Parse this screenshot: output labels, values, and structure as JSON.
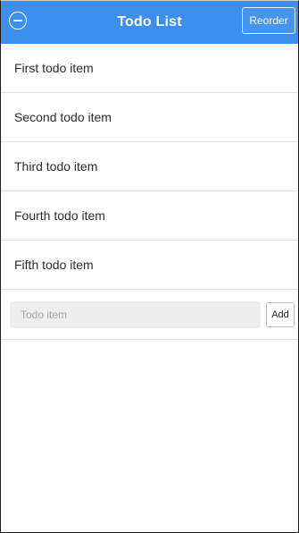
{
  "header": {
    "title": "Todo List",
    "reorder_label": "Reorder",
    "left_icon": "remove-circle-icon",
    "background_color": "#3d8fef"
  },
  "todos": [
    {
      "label": "First todo item"
    },
    {
      "label": "Second todo item"
    },
    {
      "label": "Third todo item"
    },
    {
      "label": "Fourth todo item"
    },
    {
      "label": "Fifth todo item"
    }
  ],
  "add_form": {
    "placeholder": "Todo item",
    "value": "",
    "add_label": "Add"
  }
}
